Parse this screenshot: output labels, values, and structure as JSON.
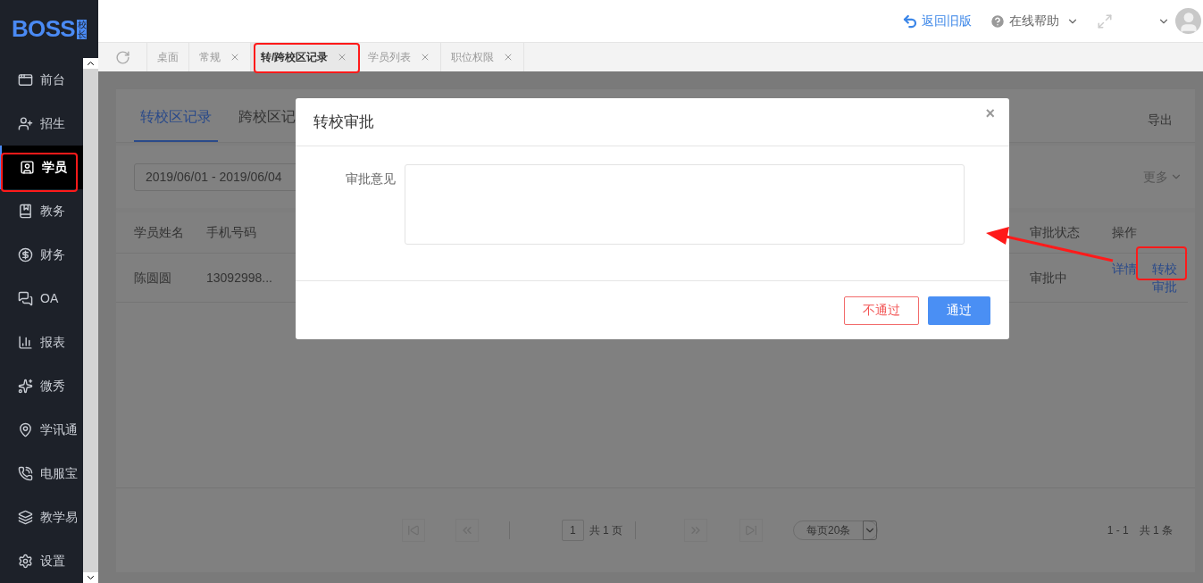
{
  "logo": {
    "text": "BOSS",
    "badge": "校长"
  },
  "sidebar": {
    "items": [
      {
        "label": "前台",
        "selected": false
      },
      {
        "label": "招生",
        "selected": false
      },
      {
        "label": "学员",
        "selected": true
      },
      {
        "label": "教务",
        "selected": false
      },
      {
        "label": "财务",
        "selected": false
      },
      {
        "label": "OA",
        "selected": false
      },
      {
        "label": "报表",
        "selected": false
      },
      {
        "label": "微秀",
        "selected": false
      },
      {
        "label": "学讯通",
        "selected": false
      },
      {
        "label": "电服宝",
        "selected": false
      },
      {
        "label": "教学易",
        "selected": false
      },
      {
        "label": "设置",
        "selected": false
      }
    ]
  },
  "header": {
    "back_link": "返回旧版",
    "help": "在线帮助"
  },
  "tabs": [
    {
      "label": "桌面",
      "closable": false,
      "selected": false
    },
    {
      "label": "常规",
      "closable": true,
      "selected": false
    },
    {
      "label": "转/跨校区记录",
      "closable": true,
      "selected": true
    },
    {
      "label": "学员列表",
      "closable": true,
      "selected": false
    },
    {
      "label": "职位权限",
      "closable": true,
      "selected": false
    }
  ],
  "page": {
    "tabs": [
      {
        "label": "转校区记录",
        "selected": true
      },
      {
        "label": "跨校区记",
        "selected": false
      }
    ],
    "export": "导出",
    "date_range": "2019/06/01 - 2019/06/04",
    "more": "更多",
    "table": {
      "columns_left": [
        "学员姓名",
        "手机号码"
      ],
      "columns_right": [
        "审批状态",
        "操作"
      ],
      "rows": [
        {
          "name": "陈圆圆",
          "phone": "13092998...",
          "status": "审批中",
          "actions": [
            "详情",
            "转校审批"
          ]
        }
      ]
    },
    "pagination": {
      "page": "1",
      "pages": "共 1 页",
      "page_size": "每页20条",
      "range": "1 - 1",
      "total": "共 1 条"
    }
  },
  "modal": {
    "title": "转校审批",
    "close": "×",
    "field_label": "审批意见",
    "reject": "不通过",
    "approve": "通过"
  },
  "annotations": [
    {
      "kind": "box"
    },
    {
      "kind": "box"
    },
    {
      "kind": "box"
    },
    {
      "kind": "arrow"
    }
  ]
}
